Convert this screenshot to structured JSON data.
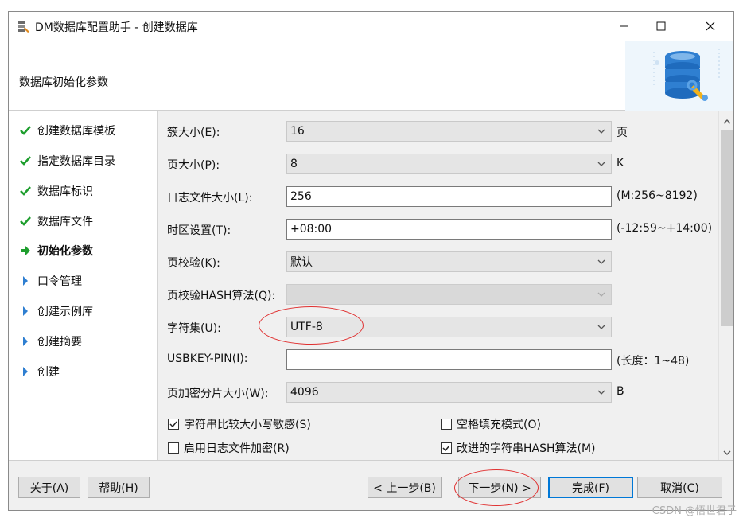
{
  "window": {
    "title": "DM数据库配置助手 - 创建数据库"
  },
  "header": {
    "title": "数据库初始化参数"
  },
  "steps": [
    {
      "label": "创建数据库模板",
      "state": "done"
    },
    {
      "label": "指定数据库目录",
      "state": "done"
    },
    {
      "label": "数据库标识",
      "state": "done"
    },
    {
      "label": "数据库文件",
      "state": "done"
    },
    {
      "label": "初始化参数",
      "state": "current"
    },
    {
      "label": "口令管理",
      "state": "pending"
    },
    {
      "label": "创建示例库",
      "state": "pending"
    },
    {
      "label": "创建摘要",
      "state": "pending"
    },
    {
      "label": "创建",
      "state": "pending"
    }
  ],
  "form": {
    "extent_size": {
      "label": "簇大小(E):",
      "value": "16",
      "unit": "页"
    },
    "page_size": {
      "label": "页大小(P):",
      "value": "8",
      "unit": "K"
    },
    "log_size": {
      "label": "日志文件大小(L):",
      "value": "256",
      "hint": "(M:256~8192)"
    },
    "time_zone": {
      "label": "时区设置(T):",
      "value": "+08:00",
      "hint": "(-12:59~+14:00)"
    },
    "page_check": {
      "label": "页校验(K):",
      "value": "默认"
    },
    "page_check_hash": {
      "label": "页校验HASH算法(Q):",
      "value": ""
    },
    "charset": {
      "label": "字符集(U):",
      "value": "UTF-8"
    },
    "usbkey_pin": {
      "label": "USBKEY-PIN(I):",
      "value": "",
      "hint": "(长度：1~48)"
    },
    "encrypt_fragment": {
      "label": "页加密分片大小(W):",
      "value": "4096",
      "unit": "B"
    },
    "case_sensitive": {
      "label": "字符串比较大小写敏感(S)",
      "checked": true
    },
    "blank_pad": {
      "label": "空格填充模式(O)",
      "checked": false
    },
    "log_encrypt": {
      "label": "启用日志文件加密(R)",
      "checked": false
    },
    "improved_hash": {
      "label": "改进的字符串HASH算法(M)",
      "checked": true
    }
  },
  "buttons": {
    "about": "关于(A)",
    "help": "帮助(H)",
    "prev": "< 上一步(B)",
    "next": "下一步(N) >",
    "finish": "完成(F)",
    "cancel": "取消(C)"
  },
  "watermark": "CSDN @悟世君子",
  "colors": {
    "accent": "#0078d7",
    "check_green": "#1e9e2e",
    "step_arrow_blue": "#2f7fd1",
    "annotation_red": "#e03030"
  }
}
